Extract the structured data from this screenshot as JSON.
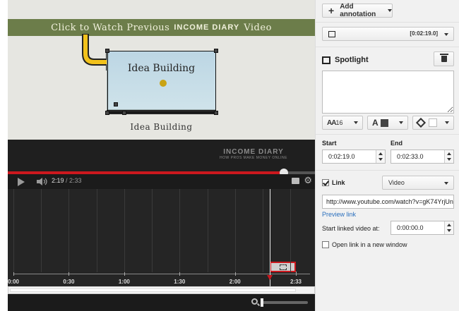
{
  "video": {
    "banner_text": "Click to Watch Previous",
    "banner_brand": "INCOME DIARY",
    "banner_suffix": "Video",
    "card_title": "Idea Building",
    "caption_below": "Idea Building",
    "watermark_title": "INCOME DIARY",
    "watermark_sub": "HOW PROS MAKE MONEY ONLINE"
  },
  "player": {
    "current_time": "2:19",
    "separator": " / ",
    "duration": "2:33",
    "progress_fraction": 0.899
  },
  "timeline": {
    "tick_labels": [
      "0:00",
      "0:30",
      "1:00",
      "1:30",
      "2:00",
      "2:33"
    ],
    "playhead_time_sec": 139,
    "duration_sec": 153,
    "annotation_start_sec": 139,
    "annotation_end_sec": 153
  },
  "editor": {
    "add_annotation_label": "Add annotation",
    "type_time": "[0:02:19.0]",
    "spotlight_title": "Spotlight",
    "font_size": "16",
    "start_label": "Start",
    "end_label": "End",
    "start_value": "0:02:19.0",
    "end_value": "0:02:33.0",
    "link_label": "Link",
    "link_checked": true,
    "link_type": "Video",
    "url_value": "http://www.youtube.com/watch?v=gK74YrjUn",
    "preview_link": "Preview link",
    "linked_start_label": "Start linked video at:",
    "linked_start_value": "0:00:00.0",
    "new_window_label": "Open link in a new window",
    "text_color": "#444444",
    "bg_color": "#ffffff"
  },
  "colors": {
    "accent_red": "#cc181e",
    "banner_green": "#6c7d4a"
  }
}
